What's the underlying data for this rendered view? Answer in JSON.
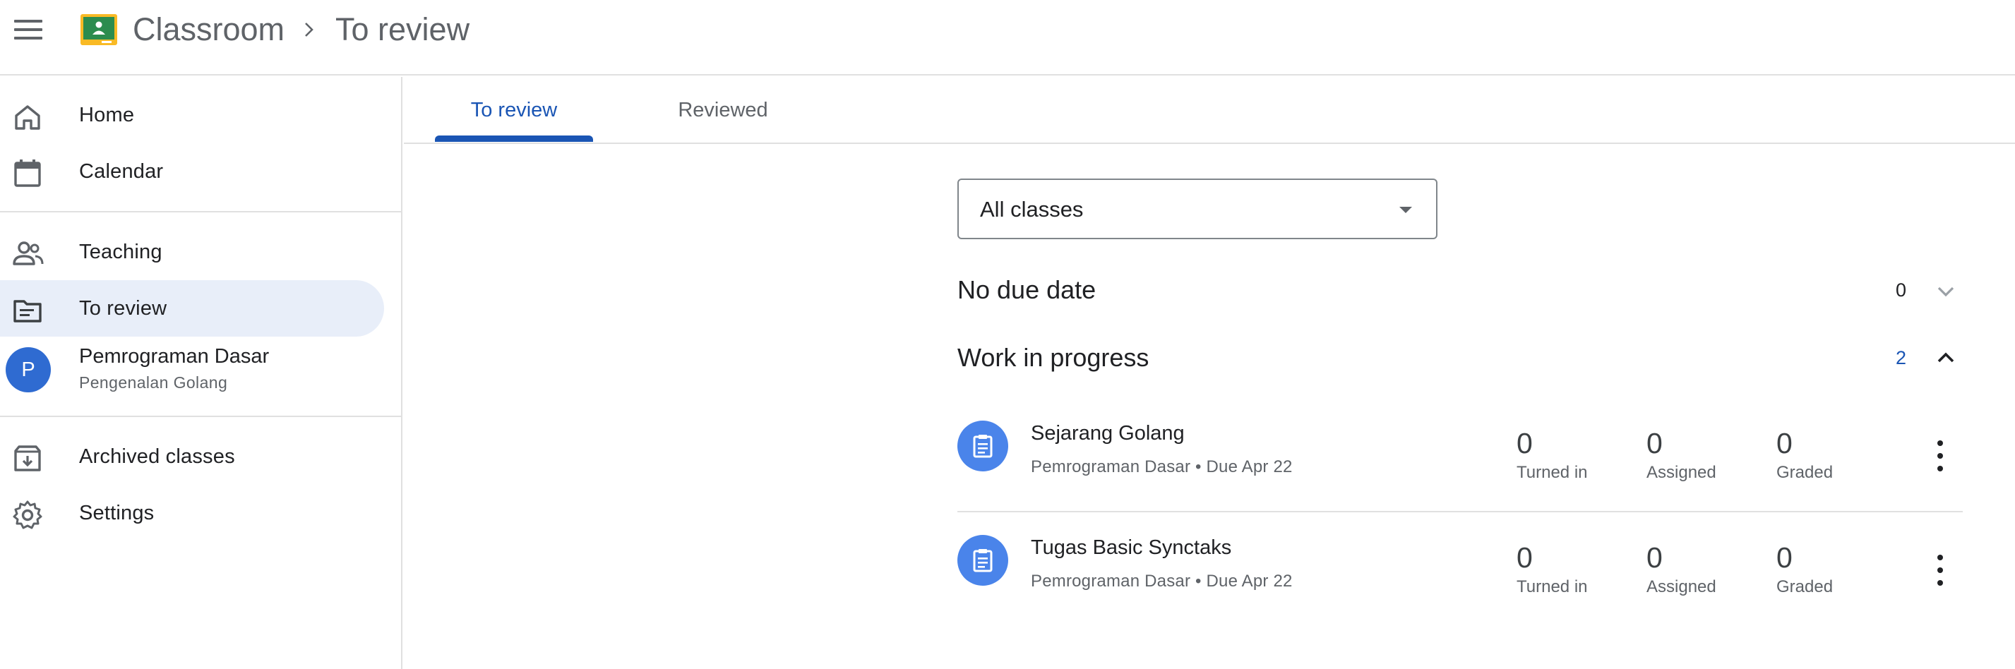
{
  "header": {
    "app_title": "Classroom",
    "breadcrumb_current": "To review"
  },
  "sidebar": {
    "items": [
      {
        "label": "Home",
        "icon": "home-icon"
      },
      {
        "label": "Calendar",
        "icon": "calendar-icon"
      },
      {
        "label": "Teaching",
        "icon": "people-icon"
      },
      {
        "label": "To review",
        "icon": "review-folder-icon",
        "active": true
      },
      {
        "label": "Archived classes",
        "icon": "archive-icon"
      },
      {
        "label": "Settings",
        "icon": "gear-icon"
      }
    ],
    "class": {
      "avatar_letter": "P",
      "name": "Pemrograman Dasar",
      "section": "Pengenalan Golang",
      "avatar_color": "#2f6bd1"
    }
  },
  "tabs": [
    {
      "label": "To review",
      "active": true
    },
    {
      "label": "Reviewed",
      "active": false
    }
  ],
  "filter": {
    "selected": "All classes"
  },
  "sections": {
    "no_due": {
      "title": "No due date",
      "count": "0",
      "expanded": false
    },
    "in_progress": {
      "title": "Work in progress",
      "count": "2",
      "expanded": true
    }
  },
  "tasks": [
    {
      "title": "Sejarang Golang",
      "meta": "Pemrograman Dasar • Due Apr 22",
      "turned_in": "0",
      "turned_in_label": "Turned in",
      "assigned": "0",
      "assigned_label": "Assigned",
      "graded": "0",
      "graded_label": "Graded"
    },
    {
      "title": "Tugas Basic Synctaks",
      "meta": "Pemrograman Dasar • Due Apr 22",
      "turned_in": "0",
      "turned_in_label": "Turned in",
      "assigned": "0",
      "assigned_label": "Assigned",
      "graded": "0",
      "graded_label": "Graded"
    }
  ],
  "colors": {
    "accent": "#1a55b4",
    "active_nav_bg": "#e8eef9",
    "task_icon_bg": "#4a84ea"
  }
}
